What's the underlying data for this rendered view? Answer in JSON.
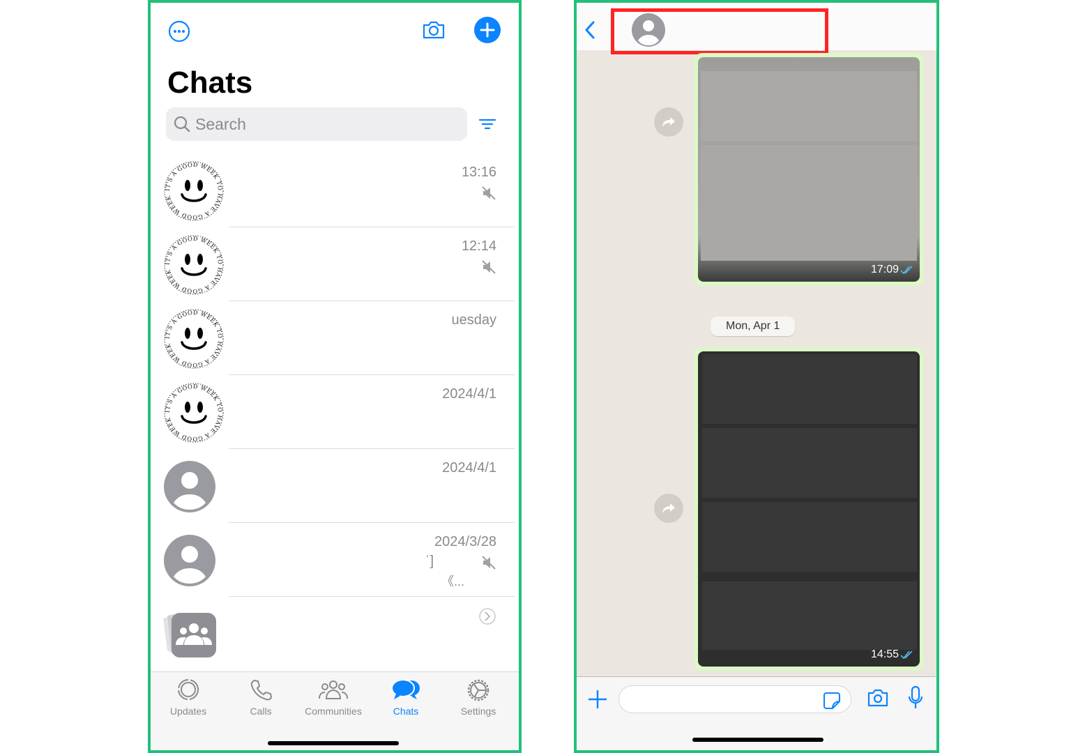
{
  "left": {
    "title": "Chats",
    "search_placeholder": "Search",
    "avatar_logo_text": "IT'S A GOOD WEEK TO HAVE A GOOD WEEK",
    "chats": [
      {
        "avatar": "smiley",
        "time": "13:16",
        "muted": true,
        "preview": ""
      },
      {
        "avatar": "smiley",
        "time": "12:14",
        "muted": true,
        "preview": ""
      },
      {
        "avatar": "smiley",
        "time": "uesday",
        "muted": false,
        "preview": ""
      },
      {
        "avatar": "smiley",
        "time": "2024/4/1",
        "muted": false,
        "preview": ""
      },
      {
        "avatar": "person",
        "time": "2024/4/1",
        "muted": false,
        "preview": ""
      },
      {
        "avatar": "person",
        "time": "2024/3/28",
        "muted": true,
        "preview": "ˈ]",
        "preview2": "《..."
      }
    ],
    "communities_row": {
      "icon": "community-icon"
    },
    "tabs": [
      {
        "label": "Updates",
        "icon": "updates-icon"
      },
      {
        "label": "Calls",
        "icon": "phone-icon"
      },
      {
        "label": "Communities",
        "icon": "communities-icon"
      },
      {
        "label": "Chats",
        "icon": "chats-icon",
        "active": true
      },
      {
        "label": "Settings",
        "icon": "gear-icon"
      }
    ]
  },
  "right": {
    "messages": [
      {
        "type": "image",
        "time": "17:09",
        "status": "read"
      },
      {
        "type": "image",
        "time": "14:55",
        "status": "read"
      }
    ],
    "date_separator": "Mon, Apr 1",
    "input_placeholder": ""
  },
  "colors": {
    "accent": "#0a84ff",
    "frame": "#22c07a",
    "highlight": "#ff2424",
    "bubble": "#dcf8c6"
  }
}
